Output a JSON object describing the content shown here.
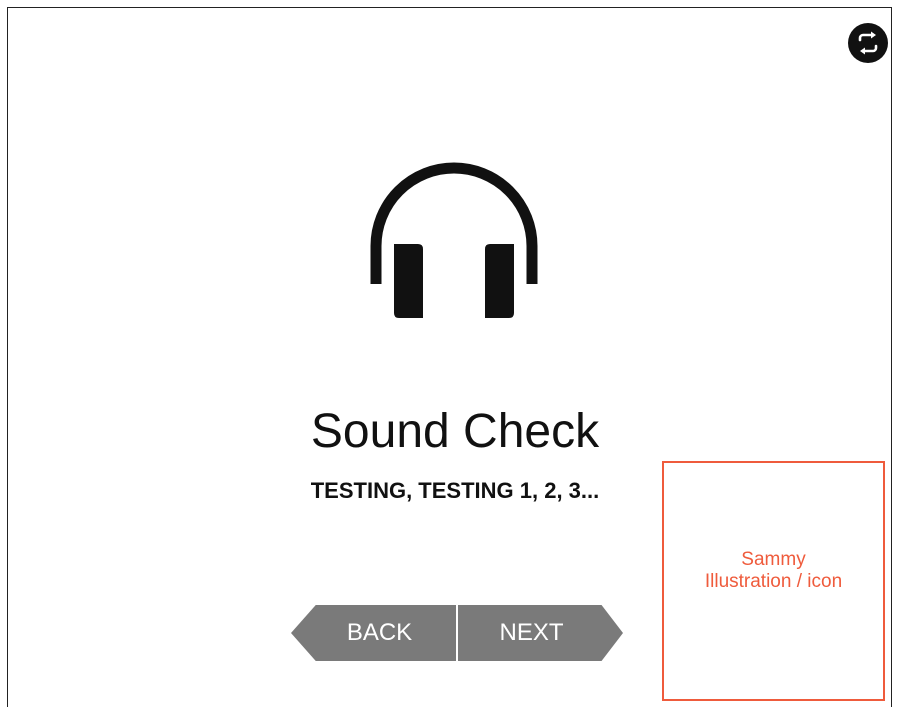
{
  "header": {
    "swap_icon": "swap-arrows-icon"
  },
  "main": {
    "hero_icon": "headphones-icon",
    "title": "Sound Check",
    "subtitle": "TESTING, TESTING 1, 2, 3..."
  },
  "navigation": {
    "back_label": "BACK",
    "next_label": "NEXT"
  },
  "placeholder": {
    "line1": "Sammy",
    "line2": "Illustration / icon"
  },
  "colors": {
    "accent": "#ef5b3c",
    "button": "#7a7a7a",
    "text": "#111111"
  }
}
